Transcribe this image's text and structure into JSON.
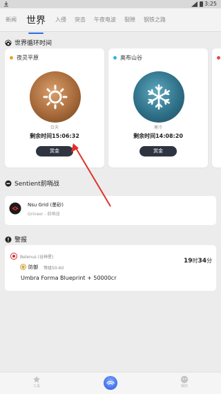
{
  "status_bar": {
    "time": "3:25"
  },
  "tabs": [
    "新闻",
    "世界",
    "入侵",
    "突击",
    "午夜电波",
    "裂隙",
    "钢铁之路"
  ],
  "world_cycle": {
    "title": "世界循环时间",
    "cards": [
      {
        "location": "夜灵平原",
        "state": "白天",
        "remaining": "剩余时间15:06:32",
        "button": "赏金",
        "dot_color": "#f0a030",
        "icon": "sun-icon"
      },
      {
        "location": "奥布山谷",
        "state": "寒冷",
        "remaining": "剩余时间14:08:20",
        "button": "赏金",
        "dot_color": "#2ab7e6",
        "icon": "snowflake-icon"
      },
      {
        "location": "魔",
        "dot_color": "#e04b4b"
      }
    ]
  },
  "sentient": {
    "title": "Sentient前哨战",
    "node": "Nsu Grid (墨砂)",
    "faction": "Grineer - 前哨战"
  },
  "alerts": {
    "title": "警报",
    "location": "Belenus (谷神星)",
    "mission": "防御",
    "level": "等级50-60",
    "time_h": "19",
    "time_h_unit": "时",
    "time_m": "34",
    "time_m_unit": "分",
    "reward": "Umbra Forma Blueprint + 50000cr"
  },
  "bottom_nav": [
    {
      "label": "工具",
      "icon": "star-icon"
    },
    {
      "label": "",
      "icon": "home-icon"
    },
    {
      "label": "我的",
      "icon": "profile-icon"
    }
  ],
  "colors": {
    "accent": "#2d6cdf",
    "button_dark": "#2e3540",
    "arrow": "#e0312a"
  }
}
